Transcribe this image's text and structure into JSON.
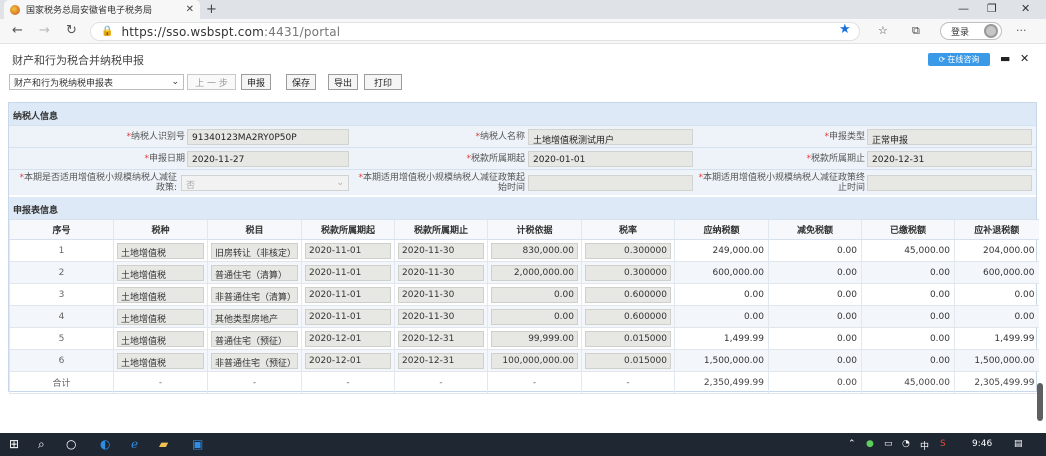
{
  "browser": {
    "tab_title": "国家税务总局安徽省电子税务局",
    "url_host": "https://sso.wsbspt.com",
    "url_rest": ":4431/portal",
    "login_label": "登录"
  },
  "page": {
    "title": "财产和行为税合并纳税申报",
    "online_label": "在线咨询"
  },
  "toolbar": {
    "select_value": "财产和行为税纳税申报表",
    "buttons": [
      "上 一 步",
      "申报",
      "保存",
      "导出",
      "打印"
    ]
  },
  "taxpayer": {
    "section_title": "纳税人信息",
    "fields": [
      {
        "label": "纳税人识别号",
        "value": "91340123MA2RY0P50P"
      },
      {
        "label": "纳税人名称",
        "value": "土地增值税测试用户"
      },
      {
        "label": "申报类型",
        "value": "正常申报"
      },
      {
        "label": "申报日期",
        "value": "2020-11-27"
      },
      {
        "label": "税款所属期起",
        "value": "2020-01-01"
      },
      {
        "label": "税款所属期止",
        "value": "2020-12-31"
      },
      {
        "label": "本期是否适用增值税小规模纳税人减征政策:",
        "value": "否"
      },
      {
        "label": "本期适用增值税小规模纳税人减征政策起始时间",
        "value": ""
      },
      {
        "label": "本期适用增值税小规模纳税人减征政策终止时间",
        "value": ""
      }
    ]
  },
  "report": {
    "section_title": "申报表信息",
    "columns": [
      "序号",
      "税种",
      "税目",
      "税款所属期起",
      "税款所属期止",
      "计税依据",
      "税率",
      "应纳税额",
      "减免税额",
      "已缴税额",
      "应补退税额"
    ],
    "rows": [
      [
        "1",
        "土地增值税",
        "旧房转让（非核定）",
        "2020-11-01",
        "2020-11-30",
        "830,000.00",
        "0.300000",
        "249,000.00",
        "0.00",
        "45,000.00",
        "204,000.00"
      ],
      [
        "2",
        "土地增值税",
        "普通住宅（清算）",
        "2020-11-01",
        "2020-11-30",
        "2,000,000.00",
        "0.300000",
        "600,000.00",
        "0.00",
        "0.00",
        "600,000.00"
      ],
      [
        "3",
        "土地增值税",
        "非普通住宅（清算）",
        "2020-11-01",
        "2020-11-30",
        "0.00",
        "0.600000",
        "0.00",
        "0.00",
        "0.00",
        "0.00"
      ],
      [
        "4",
        "土地增值税",
        "其他类型房地产",
        "2020-11-01",
        "2020-11-30",
        "0.00",
        "0.600000",
        "0.00",
        "0.00",
        "0.00",
        "0.00"
      ],
      [
        "5",
        "土地增值税",
        "普通住宅（预征）",
        "2020-12-01",
        "2020-12-31",
        "99,999.00",
        "0.015000",
        "1,499.99",
        "0.00",
        "0.00",
        "1,499.99"
      ],
      [
        "6",
        "土地增值税",
        "非普通住宅（预征）",
        "2020-12-01",
        "2020-12-31",
        "100,000,000.00",
        "0.015000",
        "1,500,000.00",
        "0.00",
        "0.00",
        "1,500,000.00"
      ]
    ],
    "total": [
      "合计",
      "-",
      "-",
      "-",
      "-",
      "-",
      "-",
      "2,350,499.99",
      "0.00",
      "45,000.00",
      "2,305,499.99"
    ]
  },
  "taskbar": {
    "ime_label": "中",
    "time": "9:46"
  }
}
